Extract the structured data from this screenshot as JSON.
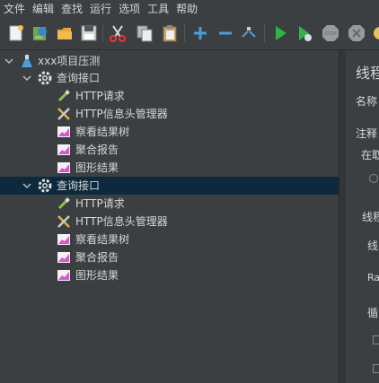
{
  "menu": [
    "文件",
    "编辑",
    "查找",
    "运行",
    "选项",
    "工具",
    "帮助"
  ],
  "toolbar": {
    "icons": [
      "new-icon",
      "templates-icon",
      "open-icon",
      "save-icon",
      "cut-icon",
      "copy-icon",
      "paste-icon",
      "expand-icon",
      "collapse-icon",
      "toggle-icon",
      "start-icon",
      "start-no-pause-icon",
      "stop-icon",
      "shutdown-icon",
      "clear-icon"
    ]
  },
  "tree": {
    "root": "xxx项目压测",
    "groups": [
      {
        "label": "查询接口",
        "children": [
          "HTTP请求",
          "HTTP信息头管理器",
          "察看结果树",
          "聚合报告",
          "图形结果"
        ]
      },
      {
        "label": "查询接口",
        "children": [
          "HTTP请求",
          "HTTP信息头管理器",
          "察看结果树",
          "聚合报告",
          "图形结果"
        ]
      }
    ]
  },
  "right_panel": {
    "title": "线程",
    "name_label": "名称",
    "comment_label": "注释",
    "error_label": "在取",
    "threads_label": "线程",
    "threads_label2": "线",
    "ramp_label": "Ra",
    "loop_label": "循"
  },
  "colors": {
    "background": "#3c3f41",
    "selection": "#0d293e",
    "text": "#d6d6d6",
    "accent_blue": "#4a9eda"
  }
}
